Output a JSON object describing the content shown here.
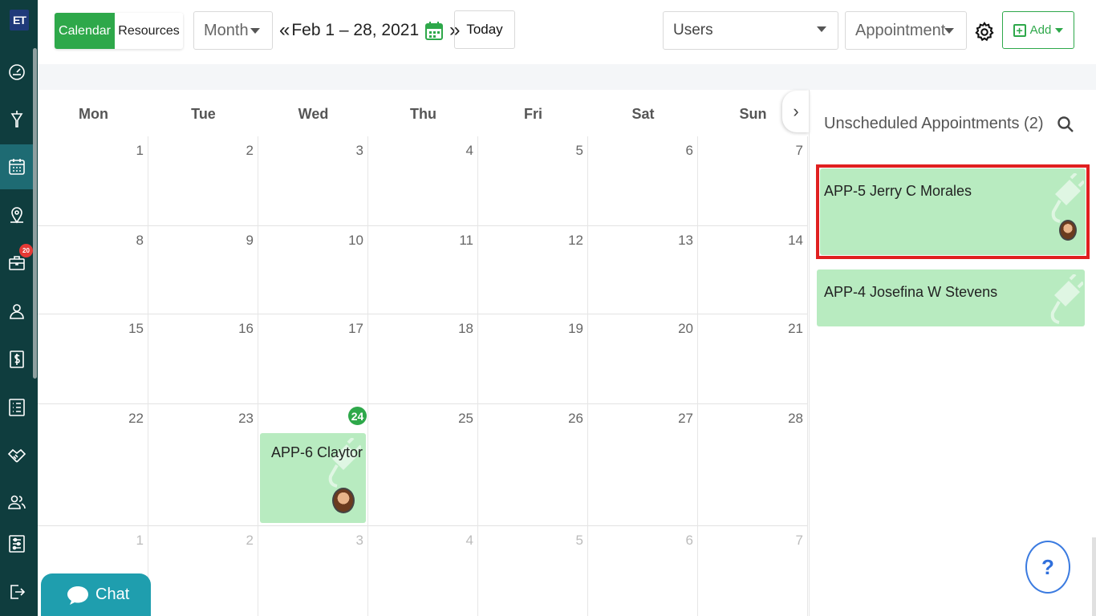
{
  "app": {
    "logo_text": "ET"
  },
  "sidebar": {
    "items": [
      {
        "icon": "dashboard-icon"
      },
      {
        "icon": "funnel-icon"
      },
      {
        "icon": "calendar-icon",
        "active": true
      },
      {
        "icon": "map-pin-icon"
      },
      {
        "icon": "briefcase-icon",
        "badge": "20"
      },
      {
        "icon": "user-icon"
      },
      {
        "icon": "dollar-icon"
      },
      {
        "icon": "list-icon"
      },
      {
        "icon": "handshake-icon"
      },
      {
        "icon": "users-icon"
      },
      {
        "icon": "settings-sliders-icon"
      },
      {
        "icon": "logout-icon"
      }
    ]
  },
  "toolbar": {
    "view_calendar": "Calendar",
    "view_resources": "Resources",
    "period": "Month",
    "prev": "«",
    "range": "Feb 1 – 28, 2021",
    "next": "»",
    "today": "Today",
    "users": "Users",
    "type": "Appointment",
    "add": "Add"
  },
  "calendar": {
    "weekdays": [
      "Mon",
      "Tue",
      "Wed",
      "Thu",
      "Fri",
      "Sat",
      "Sun"
    ],
    "weeks": [
      [
        "1",
        "2",
        "3",
        "4",
        "5",
        "6",
        "7"
      ],
      [
        "8",
        "9",
        "10",
        "11",
        "12",
        "13",
        "14"
      ],
      [
        "15",
        "16",
        "17",
        "18",
        "19",
        "20",
        "21"
      ],
      [
        "22",
        "23",
        "24",
        "25",
        "26",
        "27",
        "28"
      ],
      [
        "1",
        "2",
        "3",
        "4",
        "5",
        "6",
        "7"
      ]
    ],
    "today": "24",
    "event": {
      "title": "APP-6 Claytor"
    }
  },
  "panel": {
    "title": "Unscheduled Appointments (2)",
    "cards": [
      {
        "title": "APP-5 Jerry C Morales"
      },
      {
        "title": "APP-4 Josefina W Stevens"
      }
    ]
  },
  "help": {
    "label": "?"
  },
  "chat": {
    "label": "Chat"
  },
  "colors": {
    "accent": "#2ea84a",
    "sidebar": "#0f3d3e",
    "event": "#b8ebc0",
    "highlight": "#e02020"
  }
}
